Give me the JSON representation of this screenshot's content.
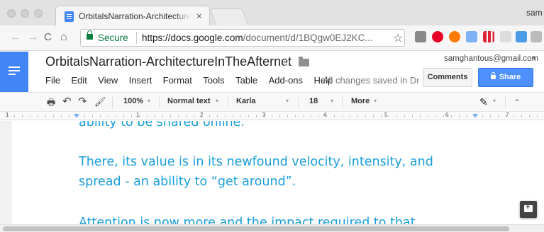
{
  "browser": {
    "tab": {
      "title": "OrbitalsNarration-ArchitectureInTheAfternet",
      "close": "×"
    },
    "profile_name": "sam",
    "nav": {
      "back": "←",
      "forward": "→",
      "reload": "C",
      "home": "⌂"
    },
    "address": {
      "secure_label": "Secure",
      "url_domain": "https://docs.google.com",
      "url_path": "/document/d/1BQgw0EJ2KC...",
      "star": "☆"
    },
    "extensions": [
      "gallery-icon",
      "pinterest-icon",
      "firefox-icon",
      "docs-icon",
      "bars-icon",
      "cloud-icon",
      "picture-icon",
      "camera-icon"
    ],
    "menu_dots": "⋮"
  },
  "docs": {
    "title": "OrbitalsNarration-ArchitectureInTheAfternet",
    "title_star": "☆",
    "menu": [
      "File",
      "Edit",
      "View",
      "Insert",
      "Format",
      "Tools",
      "Table",
      "Add-ons",
      "Help"
    ],
    "save_status": "All changes saved in Drive",
    "account_email": "samghantous@gmail.com",
    "account_caret": "▾",
    "comments_label": "Comments",
    "share_label": "Share",
    "accent_color": "#4d90fe"
  },
  "format_toolbar": {
    "print": "🖶",
    "undo": "↶",
    "redo": "↷",
    "paint": "🖌",
    "zoom": "100%",
    "style": "Normal text",
    "font": "Karla",
    "size": "18",
    "more": "More",
    "caret": "▾",
    "pen": "✎",
    "collapse": "⌃"
  },
  "ruler": {
    "numbers": [
      "1",
      "1",
      "2",
      "3",
      "4",
      "5",
      "6",
      "7"
    ]
  },
  "document": {
    "text_color": "#1a9ed8",
    "lines": [
      "ability to be shared online.",
      "There, its value is in its newfound velocity, intensity, and",
      "spread - an ability to “get around”.",
      "Attention is now more and the impact required to that"
    ]
  }
}
